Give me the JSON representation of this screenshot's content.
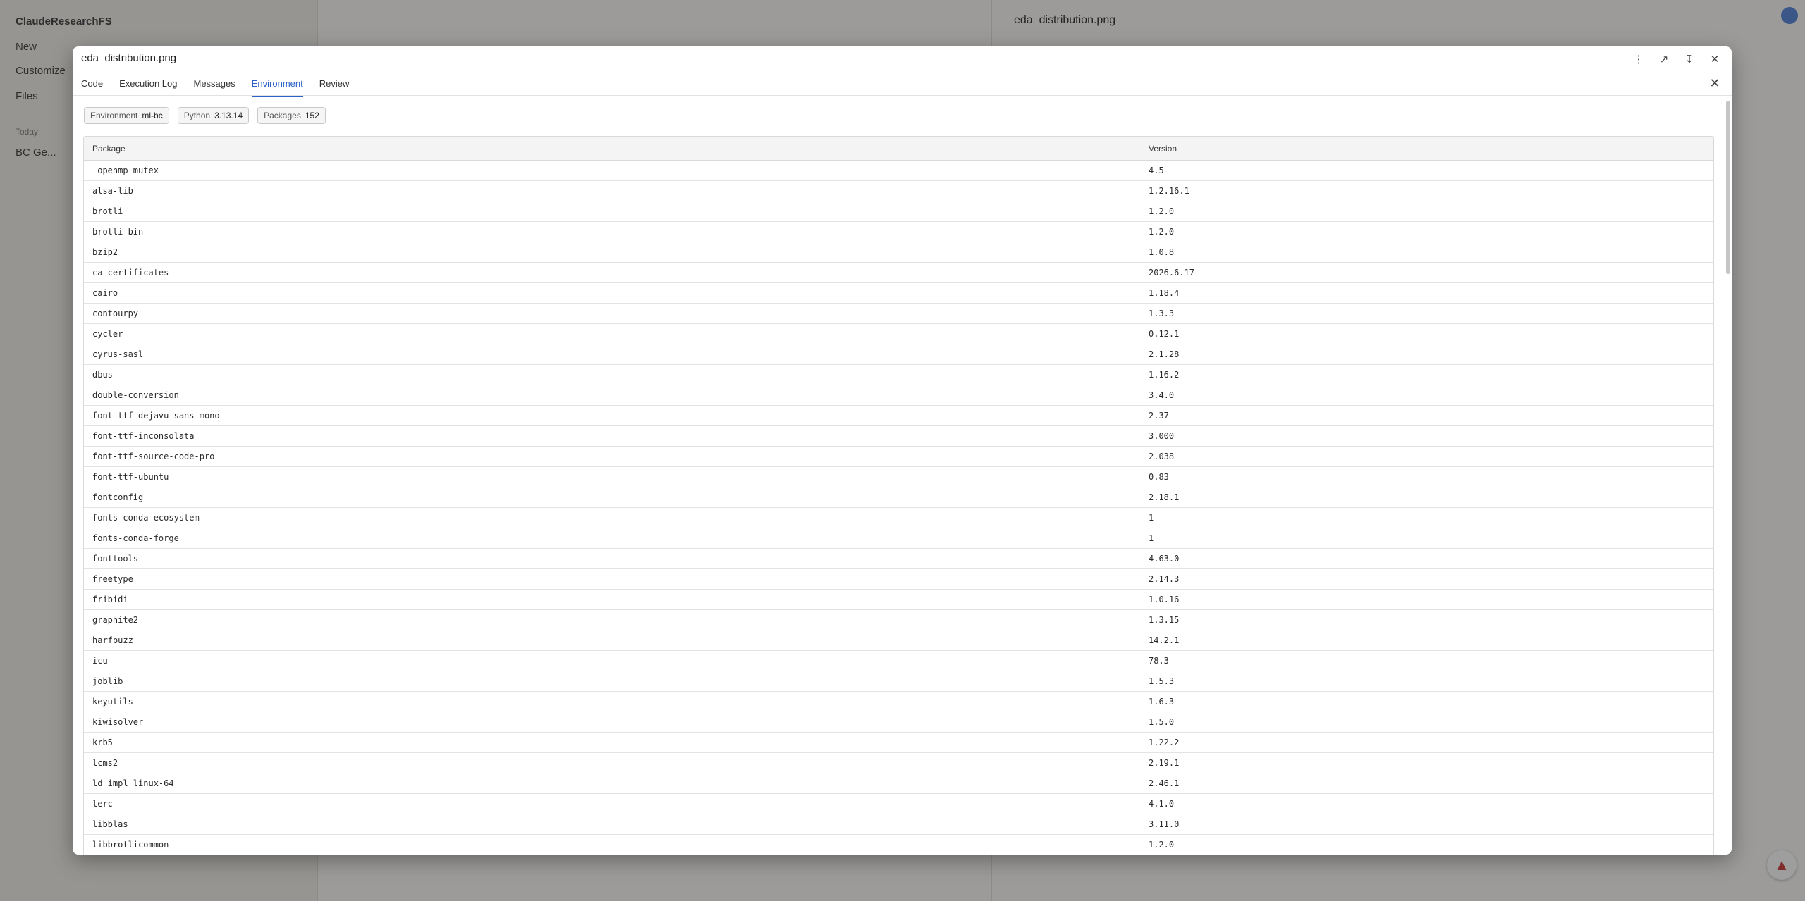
{
  "modal": {
    "title": "eda_distribution.png",
    "tabs": [
      {
        "label": "Code"
      },
      {
        "label": "Execution Log"
      },
      {
        "label": "Messages"
      },
      {
        "label": "Environment"
      },
      {
        "label": "Review"
      }
    ],
    "active_tab": "Environment",
    "badges": {
      "environment_label": "Environment",
      "environment_value": "ml-bc",
      "python_label": "Python",
      "python_value": "3.13.14",
      "packages_label": "Packages",
      "packages_value": "152"
    },
    "table": {
      "headers": [
        "Package",
        "Version"
      ],
      "rows": [
        [
          "_openmp_mutex",
          "4.5"
        ],
        [
          "alsa-lib",
          "1.2.16.1"
        ],
        [
          "brotli",
          "1.2.0"
        ],
        [
          "brotli-bin",
          "1.2.0"
        ],
        [
          "bzip2",
          "1.0.8"
        ],
        [
          "ca-certificates",
          "2026.6.17"
        ],
        [
          "cairo",
          "1.18.4"
        ],
        [
          "contourpy",
          "1.3.3"
        ],
        [
          "cycler",
          "0.12.1"
        ],
        [
          "cyrus-sasl",
          "2.1.28"
        ],
        [
          "dbus",
          "1.16.2"
        ],
        [
          "double-conversion",
          "3.4.0"
        ],
        [
          "font-ttf-dejavu-sans-mono",
          "2.37"
        ],
        [
          "font-ttf-inconsolata",
          "3.000"
        ],
        [
          "font-ttf-source-code-pro",
          "2.038"
        ],
        [
          "font-ttf-ubuntu",
          "0.83"
        ],
        [
          "fontconfig",
          "2.18.1"
        ],
        [
          "fonts-conda-ecosystem",
          "1"
        ],
        [
          "fonts-conda-forge",
          "1"
        ],
        [
          "fonttools",
          "4.63.0"
        ],
        [
          "freetype",
          "2.14.3"
        ],
        [
          "fribidi",
          "1.0.16"
        ],
        [
          "graphite2",
          "1.3.15"
        ],
        [
          "harfbuzz",
          "14.2.1"
        ],
        [
          "icu",
          "78.3"
        ],
        [
          "joblib",
          "1.5.3"
        ],
        [
          "keyutils",
          "1.6.3"
        ],
        [
          "kiwisolver",
          "1.5.0"
        ],
        [
          "krb5",
          "1.22.2"
        ],
        [
          "lcms2",
          "2.19.1"
        ],
        [
          "ld_impl_linux-64",
          "2.46.1"
        ],
        [
          "lerc",
          "4.1.0"
        ],
        [
          "libblas",
          "3.11.0"
        ],
        [
          "libbrotlicommon",
          "1.2.0"
        ]
      ]
    }
  },
  "background": {
    "sidebar": {
      "workspace": "ClaudeResearchFS",
      "new": "New",
      "customize": "Customize",
      "files": "Files",
      "today": "Today",
      "recent": "BC Ge..."
    },
    "right_panel_title": "eda_distribution.png"
  },
  "icons": {
    "more": "more-vertical-icon",
    "open_external": "external-link-icon",
    "download": "download-icon",
    "close": "close-icon"
  }
}
